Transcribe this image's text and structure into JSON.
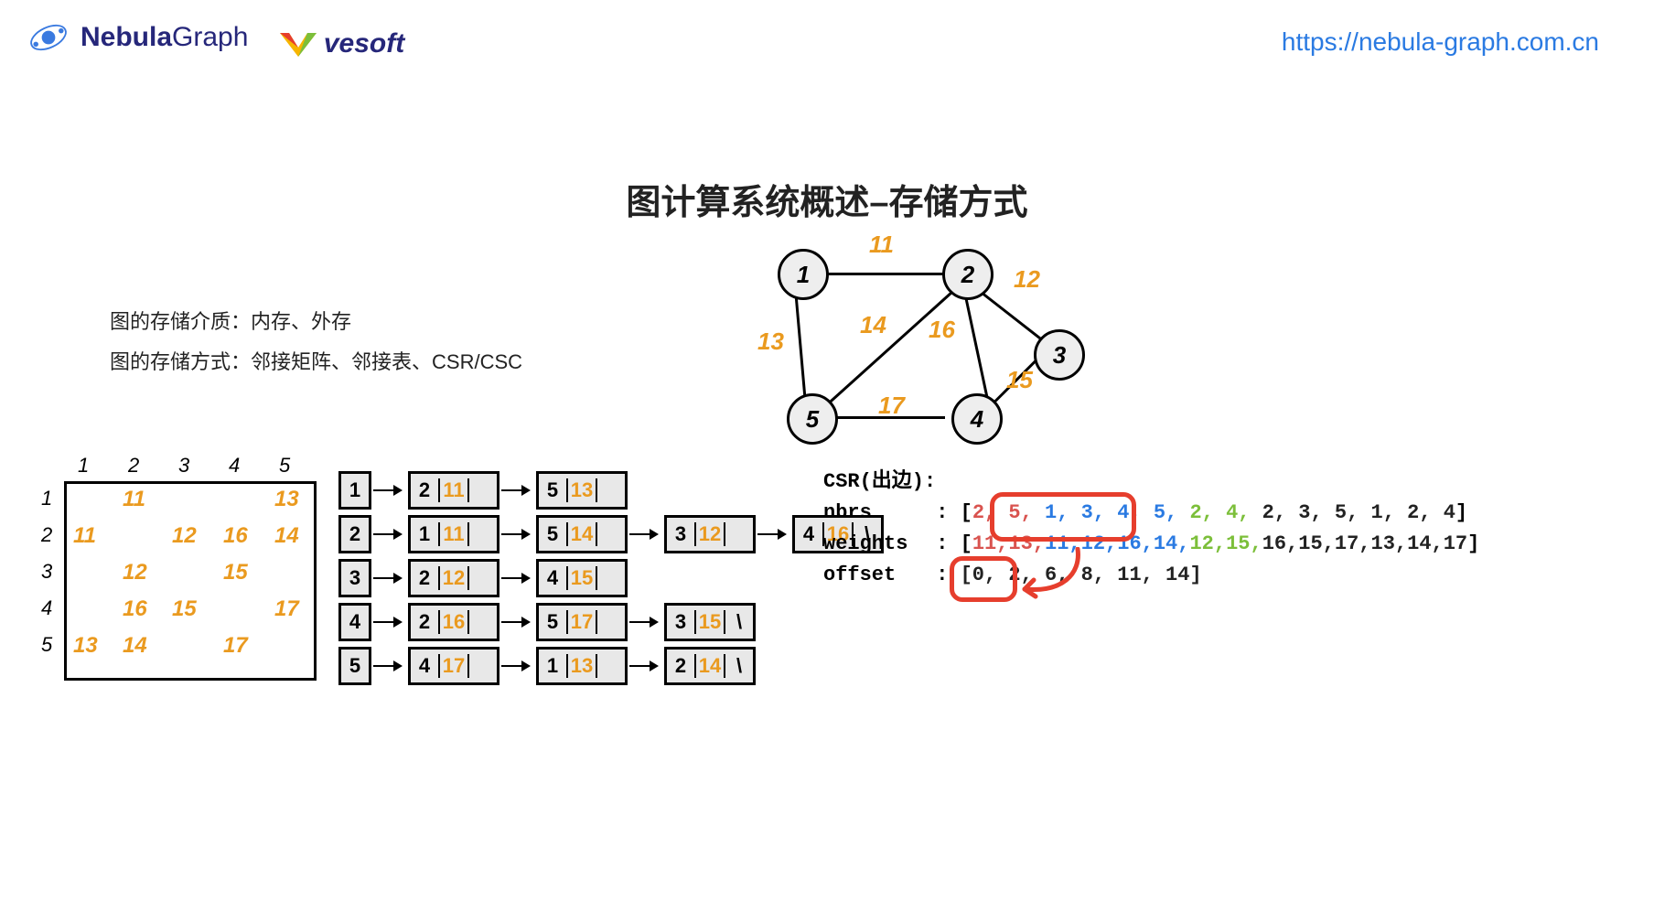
{
  "header": {
    "brand_bold": "Nebula",
    "brand_rest": "Graph",
    "vesoft": "vesoft",
    "url": "https://nebula-graph.com.cn"
  },
  "title": "图计算系统概述–存储方式",
  "bullets": {
    "line1": "图的存储介质：内存、外存",
    "line2": "图的存储方式：邻接矩阵、邻接表、CSR/CSC"
  },
  "graph": {
    "nodes": {
      "n1": "1",
      "n2": "2",
      "n3": "3",
      "n4": "4",
      "n5": "5"
    },
    "edges": {
      "e12": "11",
      "e23": "12",
      "e15": "13",
      "e25": "14",
      "e34": "15",
      "e24": "16",
      "e45": "17"
    }
  },
  "adj_matrix": {
    "cols": [
      "1",
      "2",
      "3",
      "4",
      "5"
    ],
    "rows": [
      "1",
      "2",
      "3",
      "4",
      "5"
    ],
    "cells": {
      "r1c2": "11",
      "r1c5": "13",
      "r2c1": "11",
      "r2c3": "12",
      "r2c4": "16",
      "r2c5": "14",
      "r3c2": "12",
      "r3c4": "15",
      "r4c2": "16",
      "r4c3": "15",
      "r4c5": "17",
      "r5c1": "13",
      "r5c2": "14",
      "r5c4": "17"
    }
  },
  "adj_list": {
    "rows": [
      {
        "id": "1",
        "cells": [
          {
            "nbr": "2",
            "w": "11"
          },
          {
            "nbr": "5",
            "w": "13"
          }
        ]
      },
      {
        "id": "2",
        "cells": [
          {
            "nbr": "1",
            "w": "11"
          },
          {
            "nbr": "5",
            "w": "14"
          },
          {
            "nbr": "3",
            "w": "12"
          },
          {
            "nbr": "4",
            "w": "16"
          }
        ],
        "term": "\\"
      },
      {
        "id": "3",
        "cells": [
          {
            "nbr": "2",
            "w": "12"
          },
          {
            "nbr": "4",
            "w": "15"
          }
        ]
      },
      {
        "id": "4",
        "cells": [
          {
            "nbr": "2",
            "w": "16"
          },
          {
            "nbr": "5",
            "w": "17"
          },
          {
            "nbr": "3",
            "w": "15"
          }
        ],
        "term": "\\"
      },
      {
        "id": "5",
        "cells": [
          {
            "nbr": "4",
            "w": "17"
          },
          {
            "nbr": "1",
            "w": "13"
          },
          {
            "nbr": "2",
            "w": "14"
          }
        ],
        "term": "\\"
      }
    ]
  },
  "csr": {
    "heading": "CSR(出边):",
    "labels": {
      "nbrs": "nbrs",
      "weights": "weights",
      "offset": "offset"
    },
    "sep": " : ",
    "nbrs": {
      "g1": "2, 5,",
      "g2": " 1, 3, 4, 5,",
      "g3": " 2, 4,",
      "rest": " 2, 3, 5, 1, 2, 4"
    },
    "weights": {
      "g1": "11,13,",
      "g2": "11,12,16,14,",
      "g3": "12,15,",
      "rest": "16,15,17,13,14,17"
    },
    "offset": "[0, 2, 6, 8, 11, 14]"
  }
}
